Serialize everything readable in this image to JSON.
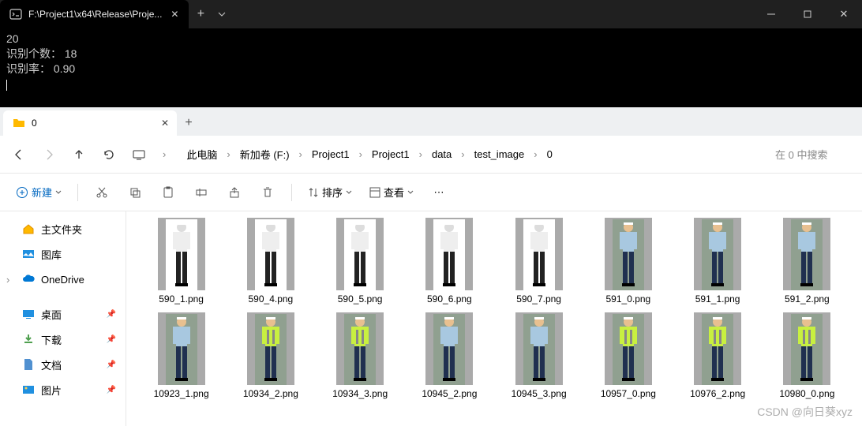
{
  "console": {
    "tab_title": "F:\\Project1\\x64\\Release\\Proje...",
    "lines": [
      "20",
      "识别个数： 18",
      "识别率： 0.90"
    ]
  },
  "explorer": {
    "tab_title": "0",
    "breadcrumbs": [
      "此电脑",
      "新加卷 (F:)",
      "Project1",
      "Project1",
      "data",
      "test_image",
      "0"
    ],
    "search_placeholder": "在 0 中搜索",
    "toolbar": {
      "new_label": "新建",
      "sort_label": "排序",
      "view_label": "查看"
    },
    "sidebar": {
      "home": "主文件夹",
      "gallery": "图库",
      "onedrive": "OneDrive",
      "desktop": "桌面",
      "downloads": "下载",
      "documents": "文档",
      "pictures": "图片"
    },
    "files_row1": [
      {
        "name": "590_1.png",
        "mono": true
      },
      {
        "name": "590_4.png",
        "mono": true
      },
      {
        "name": "590_5.png",
        "mono": true
      },
      {
        "name": "590_6.png",
        "mono": true
      },
      {
        "name": "590_7.png",
        "mono": true
      },
      {
        "name": "591_0.png",
        "color": true
      },
      {
        "name": "591_1.png",
        "color": true
      },
      {
        "name": "591_2.png",
        "color": true
      }
    ],
    "files_row2": [
      {
        "name": "10923_1.png",
        "color": true
      },
      {
        "name": "10934_2.png",
        "color": true,
        "vest": true
      },
      {
        "name": "10934_3.png",
        "color": true,
        "vest": true
      },
      {
        "name": "10945_2.png",
        "color": true
      },
      {
        "name": "10945_3.png",
        "color": true
      },
      {
        "name": "10957_0.png",
        "color": true,
        "vest": true
      },
      {
        "name": "10976_2.png",
        "color": true,
        "vest": true
      },
      {
        "name": "10980_0.png",
        "color": true,
        "vest": true
      }
    ]
  },
  "watermark": "CSDN @向日葵xyz"
}
